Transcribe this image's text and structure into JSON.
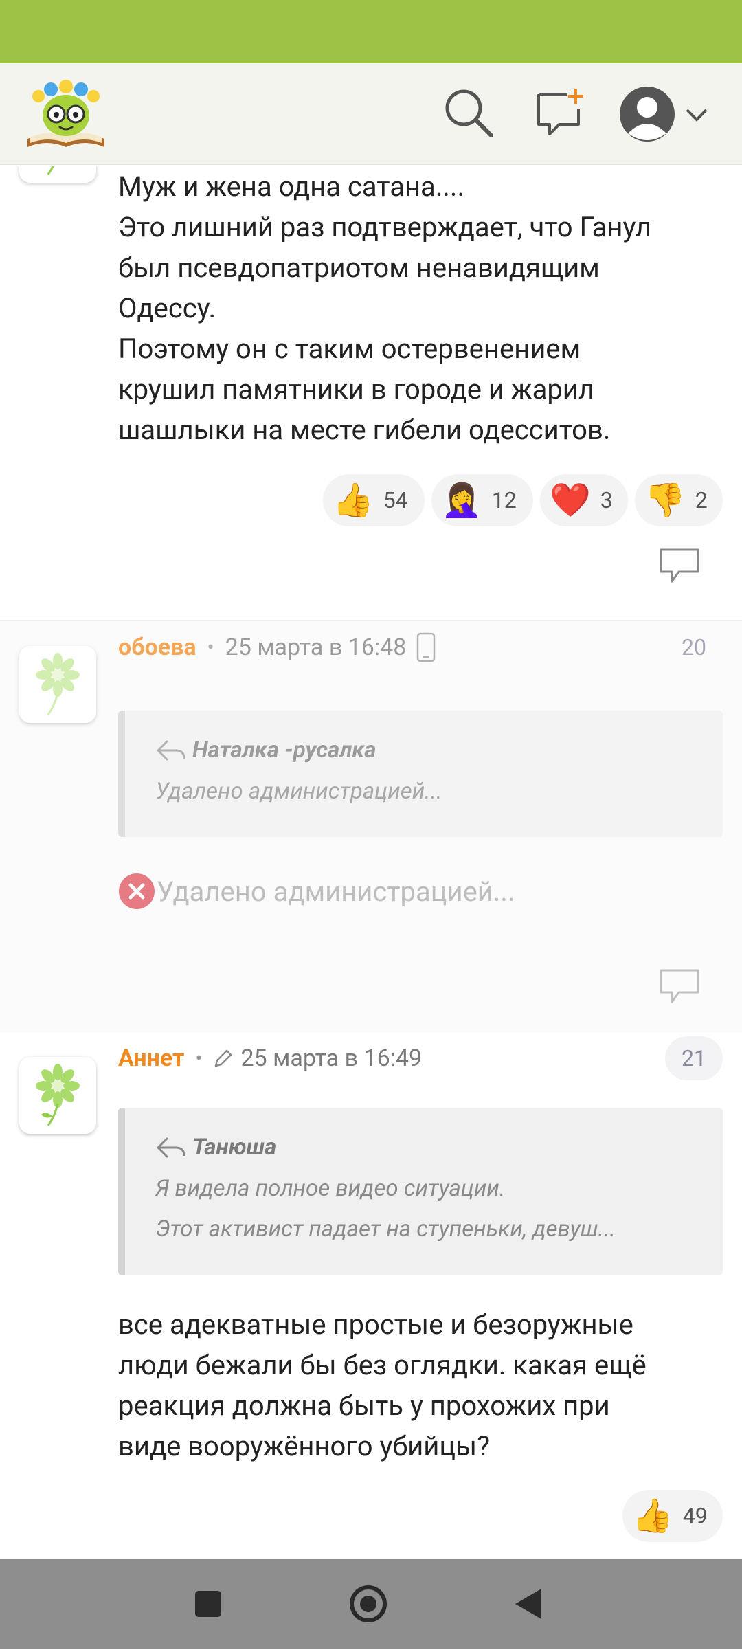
{
  "app": {
    "logo_name": "site-logo"
  },
  "comments": [
    {
      "text_lines": [
        "Муж и жена одна сатана....",
        "Это лишний раз подтверждает, что Ганул",
        "был псевдопатриотом ненавидящим",
        "Одессу.",
        "Поэтому он с таким остервенением",
        "крушил памятники в городе и жарил",
        "шашлыки на месте гибели одесситов."
      ],
      "reactions": [
        {
          "emoji": "👍",
          "count": "54"
        },
        {
          "emoji": "🤦‍♀️",
          "count": "12"
        },
        {
          "emoji": "❤️",
          "count": "3"
        },
        {
          "emoji": "👎",
          "count": "2"
        }
      ]
    },
    {
      "author": "обоева",
      "date": "25 марта в 16:48",
      "number": "20",
      "quote": {
        "author": "Наталка -русалка",
        "lines": [
          "Удалено администрацией..."
        ]
      },
      "deleted_text": "Удалено администрацией..."
    },
    {
      "author": "Аннет",
      "date": "25 марта в 16:49",
      "number": "21",
      "quote": {
        "author": "Танюша",
        "lines": [
          "Я видела полное видео ситуации.",
          "Этот активист падает на ступеньки, девуш..."
        ]
      },
      "text_lines": [
        "все адекватные простые и безоружные",
        "люди бежали бы без оглядки. какая ещё",
        "реакция должна быть у прохожих при",
        "виде вооружённого убийцы?"
      ],
      "reactions": [
        {
          "emoji": "👍",
          "count": "49"
        }
      ]
    }
  ],
  "colors": {
    "status_bar": "#9cc144",
    "author": "#f08a1e",
    "delete_icon": "#e0505a"
  }
}
